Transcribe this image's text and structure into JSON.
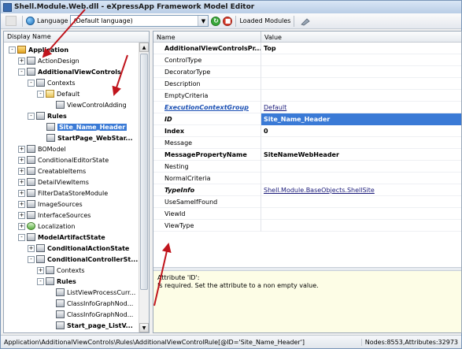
{
  "window": {
    "title": "Shell.Module.Web.dll - eXpressApp Framework Model Editor"
  },
  "toolbar": {
    "language_label": "Language",
    "language_value": "(Default language)",
    "loaded_modules_label": "Loaded Modules"
  },
  "tree": {
    "header": "Display Name",
    "nodes": [
      {
        "label": "Application",
        "bold": true,
        "icon": "app-icon",
        "expander": "-"
      },
      {
        "label": "ActionDesign",
        "bold": false,
        "icon": "node-icon",
        "expander": "+"
      },
      {
        "label": "AdditionalViewControls",
        "bold": true,
        "icon": "node-icon",
        "expander": "-"
      },
      {
        "label": "Contexts",
        "bold": false,
        "icon": "node-icon",
        "expander": "-"
      },
      {
        "label": "Default",
        "bold": false,
        "icon": "folder-icon",
        "expander": "-"
      },
      {
        "label": "ViewControlAdding",
        "bold": false,
        "icon": "node-icon",
        "expander": ""
      },
      {
        "label": "Rules",
        "bold": true,
        "icon": "node-icon",
        "expander": "-"
      },
      {
        "label": "Site_Name_Header",
        "bold": true,
        "icon": "node-icon",
        "expander": ""
      },
      {
        "label": "StartPage_WebStar...",
        "bold": true,
        "icon": "node-icon",
        "expander": ""
      },
      {
        "label": "BOModel",
        "bold": false,
        "icon": "node-icon",
        "expander": "+"
      },
      {
        "label": "ConditionalEditorState",
        "bold": false,
        "icon": "node-icon",
        "expander": "+"
      },
      {
        "label": "CreatableItems",
        "bold": false,
        "icon": "node-icon",
        "expander": "+"
      },
      {
        "label": "DetailViewItems",
        "bold": false,
        "icon": "node-icon",
        "expander": "+"
      },
      {
        "label": "FilterDataStoreModule",
        "bold": false,
        "icon": "node-icon",
        "expander": "+"
      },
      {
        "label": "ImageSources",
        "bold": false,
        "icon": "node-icon",
        "expander": "+"
      },
      {
        "label": "InterfaceSources",
        "bold": false,
        "icon": "node-icon",
        "expander": "+"
      },
      {
        "label": "Localization",
        "bold": false,
        "icon": "green-icon",
        "expander": "+"
      },
      {
        "label": "ModelArtifactState",
        "bold": true,
        "icon": "node-icon",
        "expander": "-"
      },
      {
        "label": "ConditionalActionState",
        "bold": true,
        "icon": "node-icon",
        "expander": "+"
      },
      {
        "label": "ConditionalControllerSt...",
        "bold": true,
        "icon": "node-icon",
        "expander": "-"
      },
      {
        "label": "Contexts",
        "bold": false,
        "icon": "node-icon",
        "expander": "+"
      },
      {
        "label": "Rules",
        "bold": true,
        "icon": "node-icon",
        "expander": "-"
      },
      {
        "label": "ListViewProcessCurr...",
        "bold": false,
        "icon": "node-icon",
        "expander": ""
      },
      {
        "label": "ClassInfoGraphNod...",
        "bold": false,
        "icon": "node-icon",
        "expander": ""
      },
      {
        "label": "ClassInfoGraphNod...",
        "bold": false,
        "icon": "node-icon",
        "expander": ""
      },
      {
        "label": "Start_page_ListV...",
        "bold": true,
        "icon": "node-icon",
        "expander": ""
      }
    ]
  },
  "grid": {
    "header_name": "Name",
    "header_value": "Value",
    "rows": [
      {
        "name": "AdditionalViewControlsPr...",
        "value": "Top",
        "name_style": "bold",
        "value_style": "bold"
      },
      {
        "name": "ControlType",
        "value": "",
        "name_style": "",
        "value_style": ""
      },
      {
        "name": "DecoratorType",
        "value": "",
        "name_style": "",
        "value_style": ""
      },
      {
        "name": "Description",
        "value": "",
        "name_style": "",
        "value_style": ""
      },
      {
        "name": "EmptyCriteria",
        "value": "",
        "name_style": "",
        "value_style": ""
      },
      {
        "name": "ExecutionContextGroup",
        "value": "Default",
        "name_style": "italic-link",
        "value_style": "link"
      },
      {
        "name": "ID",
        "value": "Site_Name_Header",
        "name_style": "italic",
        "value_style": "selected"
      },
      {
        "name": "Index",
        "value": "0",
        "name_style": "bold",
        "value_style": "bold"
      },
      {
        "name": "Message",
        "value": "",
        "name_style": "",
        "value_style": ""
      },
      {
        "name": "MessagePropertyName",
        "value": "SiteNameWebHeader",
        "name_style": "bold",
        "value_style": "bold"
      },
      {
        "name": "Nesting",
        "value": "",
        "name_style": "",
        "value_style": ""
      },
      {
        "name": "NormalCriteria",
        "value": "",
        "name_style": "",
        "value_style": ""
      },
      {
        "name": "TypeInfo",
        "value": "Shell.Module.BaseObjects.ShellSite",
        "name_style": "italic",
        "value_style": "link"
      },
      {
        "name": "UseSameIfFound",
        "value": "",
        "name_style": "",
        "value_style": ""
      },
      {
        "name": "ViewId",
        "value": "",
        "name_style": "",
        "value_style": ""
      },
      {
        "name": "ViewType",
        "value": "",
        "name_style": "",
        "value_style": ""
      }
    ]
  },
  "description": {
    "line1": "Attribute 'ID':",
    "line2": "Is required. Set the attribute to a non empty value."
  },
  "status": {
    "path": "Application\\AdditionalViewControls\\Rules\\AdditionalViewControlRule[@ID='Site_Name_Header']",
    "counts": "Nodes:8553,Attributes:32973"
  },
  "colors": {
    "selection": "#3a7ad6",
    "annotation_arrow": "#c0141c",
    "description_bg": "#fdfde6"
  }
}
